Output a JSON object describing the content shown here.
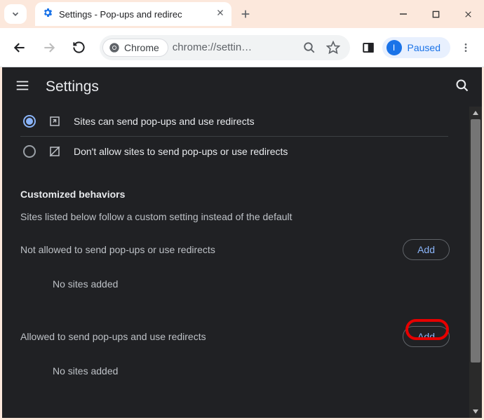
{
  "tab": {
    "title": "Settings - Pop-ups and redirec"
  },
  "omnibox": {
    "chip": "Chrome",
    "url": "chrome://settin…"
  },
  "profile": {
    "status": "Paused",
    "initial": "I"
  },
  "header": {
    "title": "Settings"
  },
  "radios": {
    "allow": {
      "label": "Sites can send pop-ups and use redirects"
    },
    "block": {
      "label": "Don't allow sites to send pop-ups or use redirects"
    }
  },
  "custom": {
    "heading": "Customized behaviors",
    "subtitle": "Sites listed below follow a custom setting instead of the default"
  },
  "lists": {
    "not_allowed": {
      "label": "Not allowed to send pop-ups or use redirects",
      "button": "Add",
      "empty": "No sites added"
    },
    "allowed": {
      "label": "Allowed to send pop-ups and use redirects",
      "button": "Add",
      "empty": "No sites added"
    }
  }
}
